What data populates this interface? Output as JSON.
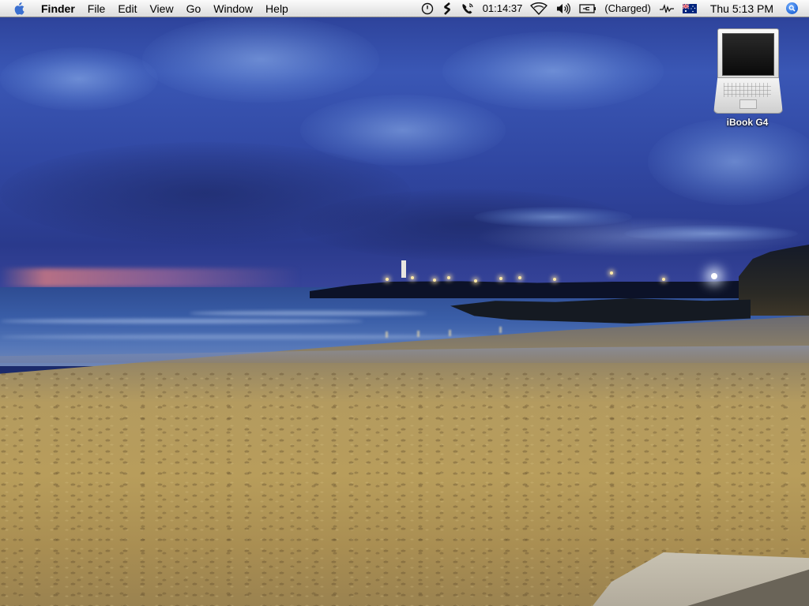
{
  "menubar": {
    "apple_icon": "apple-icon",
    "app_name": "Finder",
    "menus": [
      "File",
      "Edit",
      "View",
      "Go",
      "Window",
      "Help"
    ],
    "extras": {
      "time_machine_icon": "clock-circle-icon",
      "script_icon": "script-s-icon",
      "phone_icon": "phone-icon",
      "timer": "01:14:37",
      "wifi_icon": "wifi-icon",
      "volume_icon": "speaker-icon",
      "battery_icon": "battery-plug-icon",
      "battery_status": "(Charged)",
      "activity_icon": "activity-icon",
      "input_flag_icon": "australian-flag-icon",
      "clock": "Thu 5:13 PM",
      "spotlight_icon": "spotlight-magnifier-icon"
    }
  },
  "desktop": {
    "icons": [
      {
        "label": "iBook G4",
        "icon": "laptop-icon"
      }
    ]
  },
  "colors": {
    "menubar_top": "#fbfbfb",
    "menubar_bottom": "#dcdcdc",
    "spotlight_blue": "#2d72e0"
  }
}
